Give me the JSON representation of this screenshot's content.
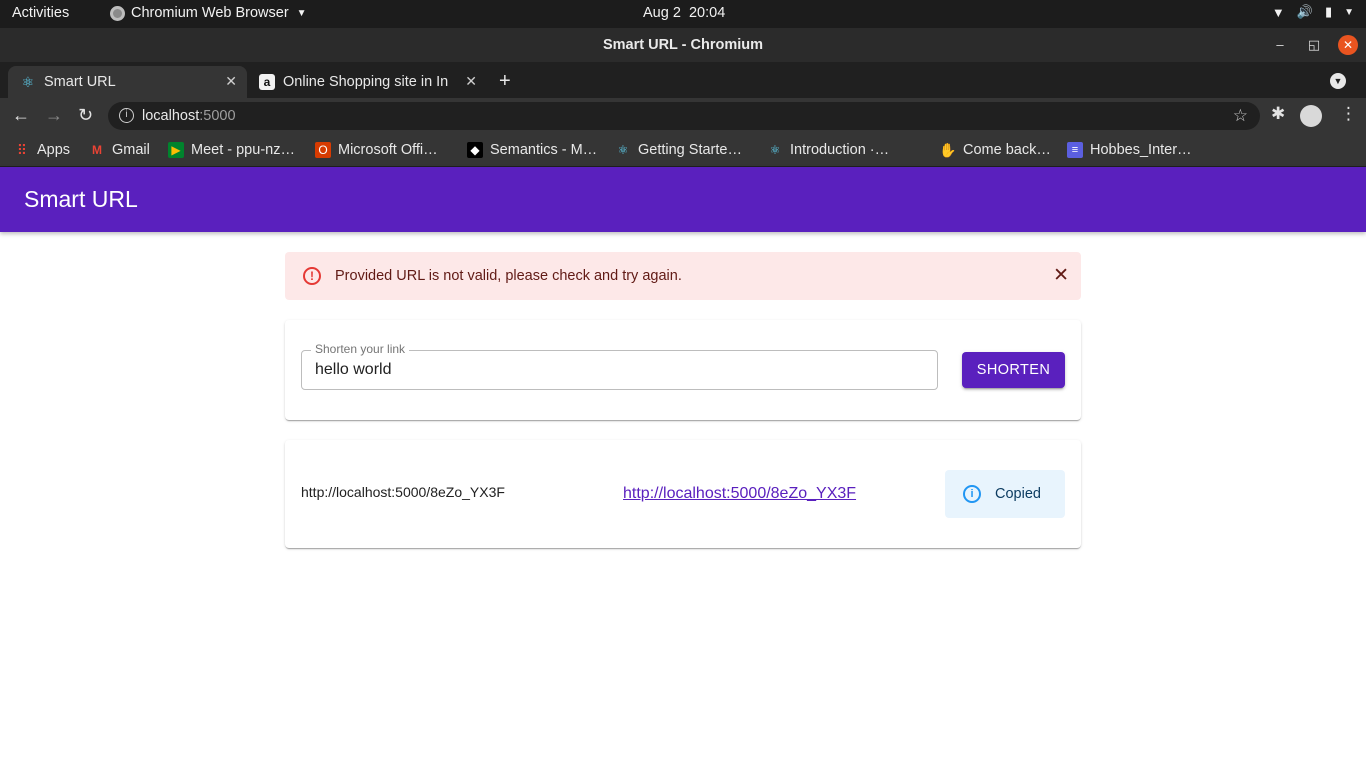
{
  "system_bar": {
    "activities": "Activities",
    "app_name": "Chromium Web Browser",
    "date": "Aug 2",
    "time": "20:04"
  },
  "window": {
    "title": "Smart URL - Chromium"
  },
  "tabs": [
    {
      "title": "Smart URL",
      "active": true
    },
    {
      "title": "Online Shopping site in In",
      "active": false
    }
  ],
  "omnibox": {
    "host": "localhost",
    "port": ":5000"
  },
  "bookmarks": [
    {
      "label": "Apps",
      "icon": "apps-grid-icon"
    },
    {
      "label": "Gmail",
      "icon": "gmail-icon"
    },
    {
      "label": "Meet - ppu-nz…",
      "icon": "meet-icon"
    },
    {
      "label": "Microsoft Offi…",
      "icon": "office-icon"
    },
    {
      "label": "Semantics - M…",
      "icon": "semantics-icon"
    },
    {
      "label": "Getting Starte…",
      "icon": "react-icon"
    },
    {
      "label": "Introduction ·…",
      "icon": "react-icon"
    },
    {
      "label": "Come back…",
      "icon": "waving-hand-icon"
    },
    {
      "label": "Hobbes_Inter…",
      "icon": "docs-icon"
    }
  ],
  "app": {
    "title": "Smart URL",
    "brand_color": "#5a20be"
  },
  "alert": {
    "severity": "error",
    "message": "Provided URL is not valid, please check and try again."
  },
  "form": {
    "label": "Shorten your link",
    "value": "hello world",
    "button": "SHORTEN"
  },
  "result": {
    "original_url": "http://localhost:5000/8eZo_YX3F",
    "short_url": "http://localhost:5000/8eZo_YX3F",
    "status": "Copied"
  }
}
